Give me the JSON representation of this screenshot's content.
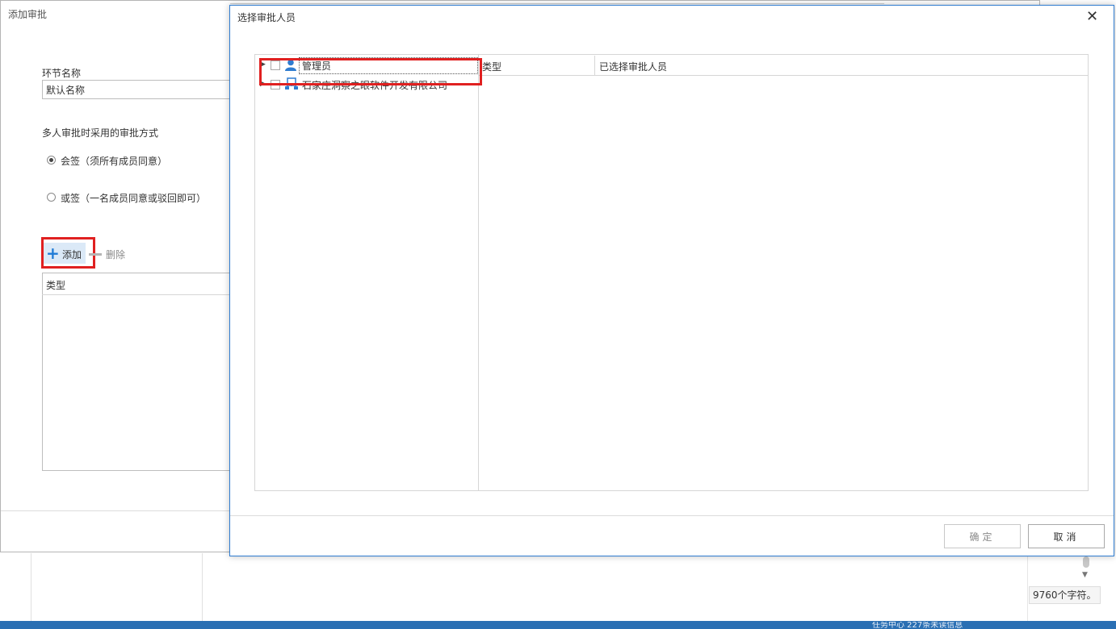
{
  "background": {
    "char_count": "9760个字符。",
    "taskbar_text": "任务中心    227条未读信息"
  },
  "add_dialog": {
    "title": "添加审批",
    "step_name_label": "环节名称",
    "step_name_value": "默认名称",
    "mode_label": "多人审批时采用的审批方式",
    "options": [
      {
        "label": "会签（须所有成员同意）",
        "selected": true
      },
      {
        "label": "或签（一名成员同意或驳回即可）",
        "selected": false
      }
    ],
    "add_label": "添加",
    "delete_label": "删除",
    "grid_header": "类型"
  },
  "select_dialog": {
    "title": "选择审批人员",
    "close_glyph": "✕",
    "tree": [
      {
        "label": "管理员",
        "icon": "user-icon",
        "checked": false
      },
      {
        "label": "石家庄洞察之眼软件开发有限公司",
        "icon": "organization-icon",
        "checked": false
      }
    ],
    "grid_columns": [
      "类型",
      "已选择审批人员"
    ],
    "ok_label": "确定",
    "cancel_label": "取消"
  }
}
